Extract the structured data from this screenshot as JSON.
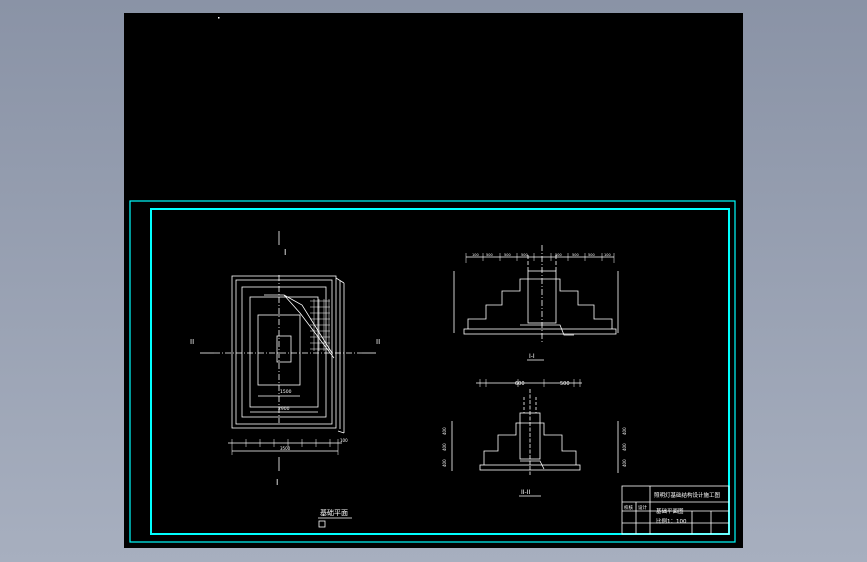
{
  "colors": {
    "background": "#000000",
    "frame": "#00ffff",
    "lines": "#ffffff"
  },
  "plan": {
    "section_mark_top": "I",
    "section_mark_bottom": "I",
    "section_mark_left": "II",
    "section_mark_right": "II",
    "inner_dim": "1500",
    "outer_dim": "2900",
    "overall_dim": "3500",
    "right_dim": "100",
    "title": "基础平面"
  },
  "section1": {
    "top_dims": [
      "100",
      "500",
      "500",
      "500",
      "500",
      "500",
      "500",
      "100"
    ],
    "label": "I-I"
  },
  "section2": {
    "dim_left": "600",
    "dim_right": "500",
    "left_dims": [
      "400",
      "400",
      "400"
    ],
    "right_dims": [
      "400",
      "400",
      "400"
    ],
    "label": "II-II"
  },
  "title_block": {
    "project": "照明灯基础结构设计施工图",
    "drawing_name": "基础平面图",
    "scale": "比例1：100",
    "review_label": "校核",
    "design_label": "设计"
  }
}
